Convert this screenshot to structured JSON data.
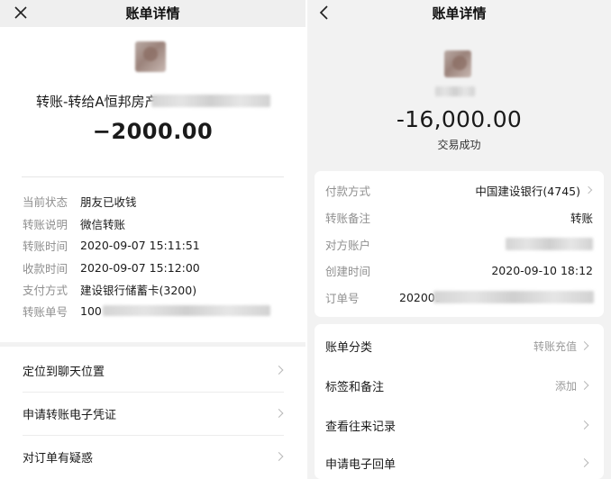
{
  "left": {
    "nav": {
      "title": "账单详情"
    },
    "title": "转账-转给A恒邦房产",
    "amount": "−2000.00",
    "details": [
      {
        "key": "当前状态",
        "value": "朋友已收钱"
      },
      {
        "key": "转账说明",
        "value": "微信转账"
      },
      {
        "key": "转账时间",
        "value": "2020-09-07 15:11:51"
      },
      {
        "key": "收款时间",
        "value": "2020-09-07 15:12:00"
      },
      {
        "key": "支付方式",
        "value": "建设银行储蓄卡(3200)"
      },
      {
        "key": "转账单号",
        "value": "100"
      }
    ],
    "actions": [
      {
        "label": "定位到聊天位置"
      },
      {
        "label": "申请转账电子凭证"
      },
      {
        "label": "对订单有疑惑"
      }
    ]
  },
  "right": {
    "nav": {
      "title": "账单详情"
    },
    "amount": "-16,000.00",
    "status": "交易成功",
    "details": [
      {
        "key": "付款方式",
        "value": "中国建设银行(4745)"
      },
      {
        "key": "转账备注",
        "value": "转账"
      },
      {
        "key": "对方账户",
        "value": ""
      },
      {
        "key": "创建时间",
        "value": "2020-09-10 18:12"
      },
      {
        "key": "订单号",
        "value": "202009"
      }
    ],
    "actions": [
      {
        "label": "账单分类",
        "hint": "转账充值"
      },
      {
        "label": "标签和备注",
        "hint": "添加"
      },
      {
        "label": "查看往来记录",
        "hint": ""
      },
      {
        "label": "申请电子回单",
        "hint": ""
      }
    ]
  },
  "colors": {
    "background": "#f2f2f2",
    "card": "#ffffff",
    "label_gray": "#8f8f8f",
    "text": "#1a1a1a"
  },
  "icons": {
    "left_nav": "close-icon",
    "right_nav": "back-arrow-icon",
    "row": "chevron-right-icon"
  }
}
